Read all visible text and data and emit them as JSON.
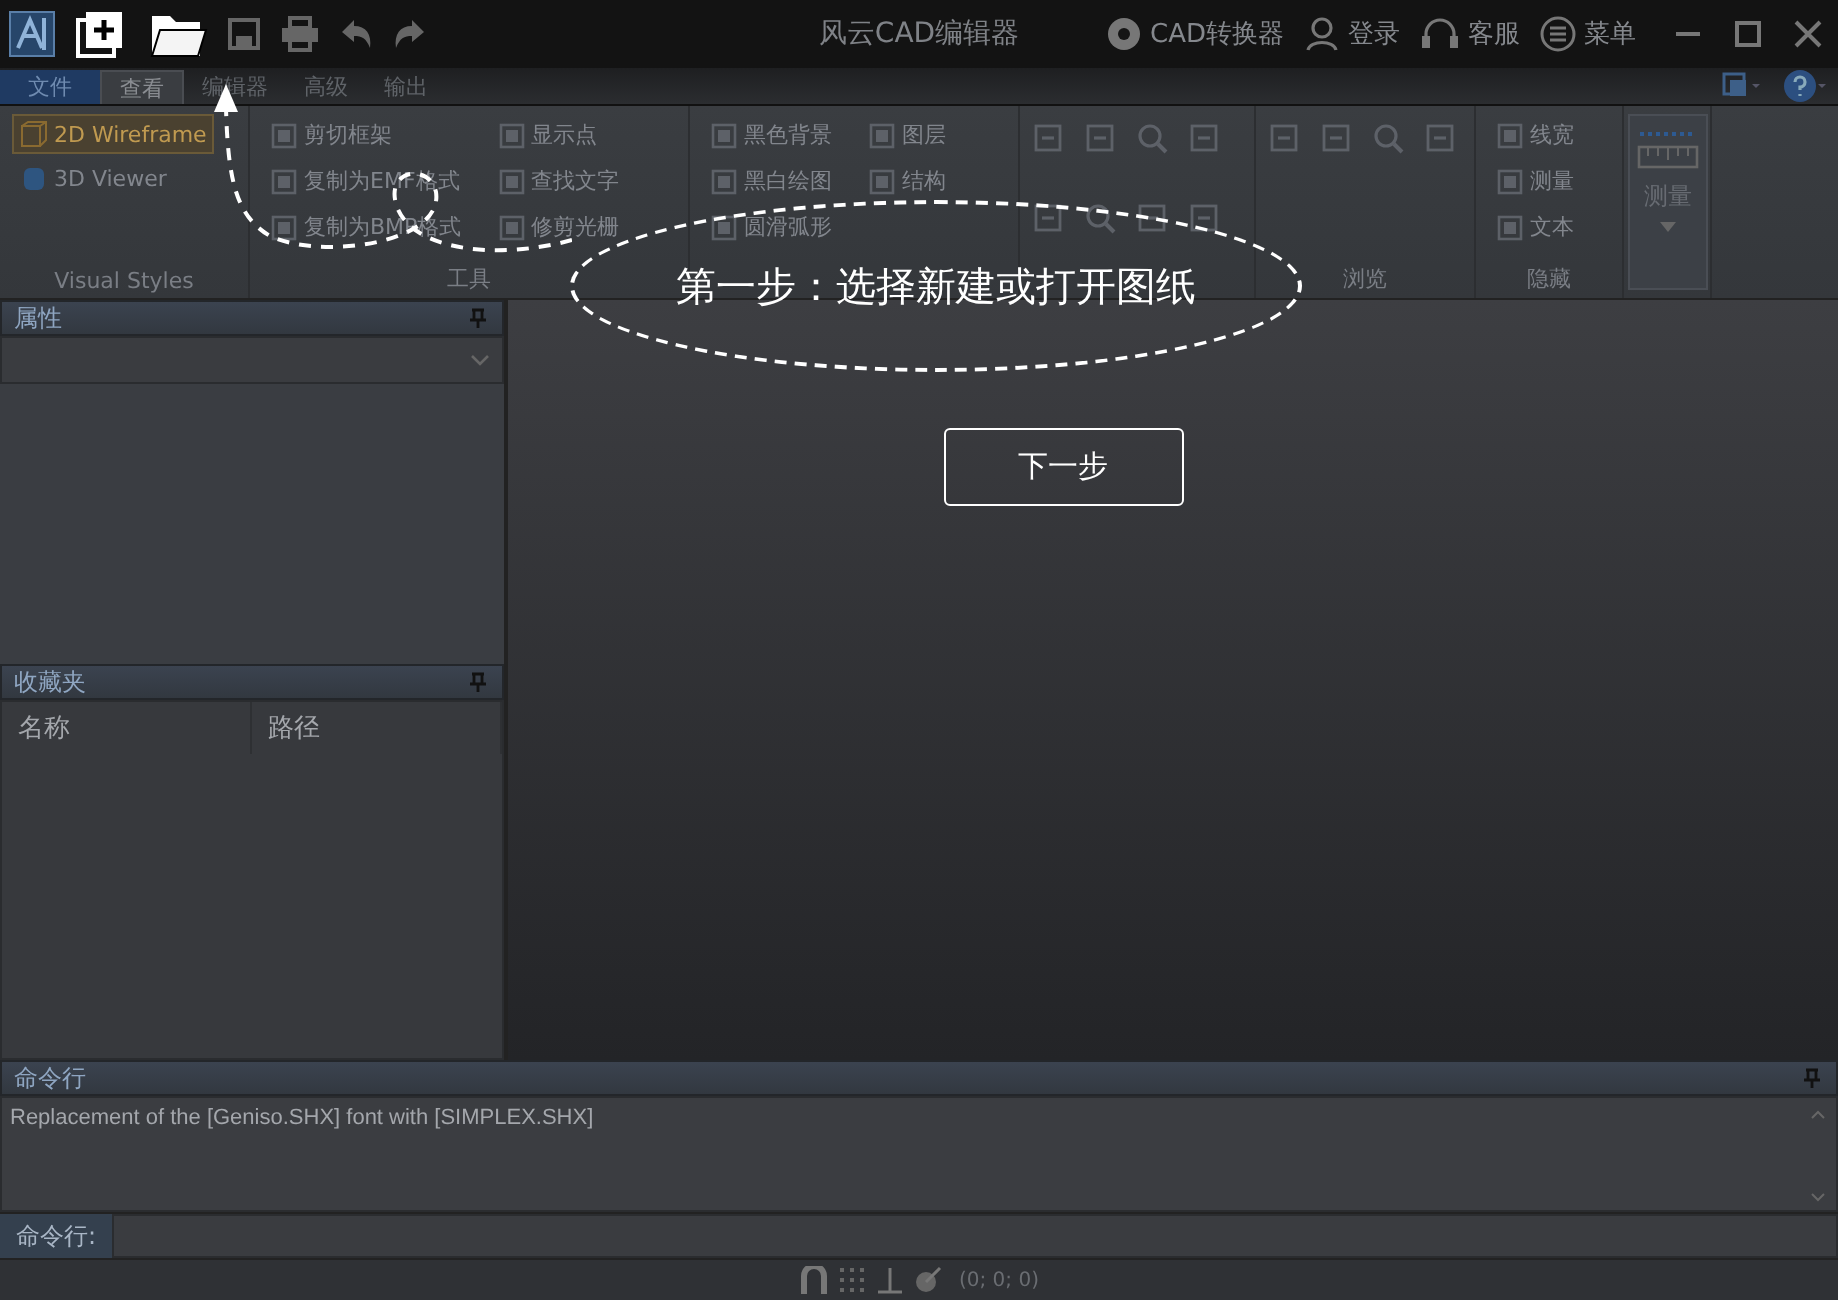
{
  "title_bar": {
    "title": "风云CAD编辑器",
    "actions": [
      {
        "label": "CAD转换器"
      },
      {
        "label": "登录"
      },
      {
        "label": "客服"
      },
      {
        "label": "菜单"
      }
    ]
  },
  "ribbon_tabs": [
    {
      "label": "文件",
      "kind": "file",
      "selected": false
    },
    {
      "label": "查看",
      "kind": "tab",
      "selected": true
    },
    {
      "label": "编辑器",
      "kind": "tab",
      "selected": false
    },
    {
      "label": "高级",
      "kind": "tab",
      "selected": false
    },
    {
      "label": "输出",
      "kind": "tab",
      "selected": false
    }
  ],
  "ribbon_groups": [
    {
      "title": "Visual Styles",
      "kind": "styles",
      "items": [
        {
          "label": "2D Wireframe",
          "selected": true
        },
        {
          "label": "3D Viewer",
          "selected": false
        }
      ]
    },
    {
      "title": "工具",
      "kind": "columns",
      "columns": [
        [
          "剪切框架",
          "复制为EMF格式",
          "复制为BMP格式"
        ],
        [
          "显示点",
          "查找文字",
          "修剪光栅"
        ]
      ]
    },
    {
      "kind": "columns",
      "columns": [
        [
          "黑色背景",
          "黑白绘图",
          "圆滑弧形"
        ],
        [
          "图层",
          "结构"
        ]
      ]
    },
    {
      "kind": "icons"
    },
    {
      "title": "浏览",
      "kind": "icons"
    },
    {
      "title": "隐藏",
      "kind": "columns",
      "columns": [
        [
          "线宽",
          "测量",
          "文本"
        ]
      ]
    },
    {
      "title": "测量",
      "kind": "big"
    }
  ],
  "properties_panel": {
    "title": "属性"
  },
  "favorites_panel": {
    "title": "收藏夹",
    "columns": [
      "名称",
      "路径"
    ]
  },
  "command_panel": {
    "title": "命令行",
    "log": "Replacement of the [Geniso.SHX] font with [SIMPLEX.SHX]",
    "prompt_label": "命令行:"
  },
  "status_bar": {
    "coordinates": "(0; 0; 0)"
  },
  "tutorial": {
    "step_text": "第一步：选择新建或打开图纸",
    "next_button": "下一步"
  }
}
